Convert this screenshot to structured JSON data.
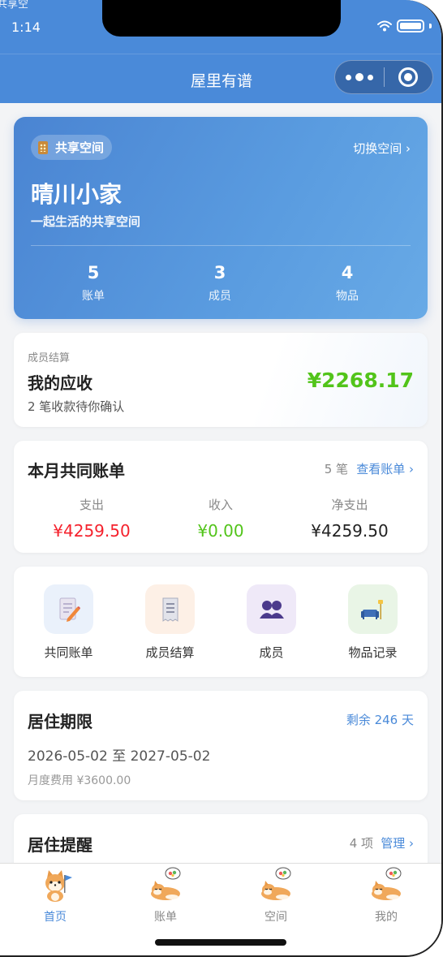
{
  "status": {
    "time": "1:14",
    "corner_text": "共享空"
  },
  "navbar": {
    "title": "屋里有谱"
  },
  "space": {
    "badge": "共享空间",
    "switch": "切换空间 ›",
    "name": "晴川小家",
    "desc": "一起生活的共享空间",
    "stats": [
      {
        "value": "5",
        "label": "账单"
      },
      {
        "value": "3",
        "label": "成员"
      },
      {
        "value": "4",
        "label": "物品"
      }
    ]
  },
  "settlement": {
    "caption": "成员结算",
    "title": "我的应收",
    "subtitle": "2 笔收款待你确认",
    "amount": "¥2268.17"
  },
  "bill": {
    "title": "本月共同账单",
    "count": "5 笔",
    "link": "查看账单 ›",
    "cols": [
      {
        "label": "支出",
        "value": "¥4259.50",
        "color": "#f5222d"
      },
      {
        "label": "收入",
        "value": "¥0.00",
        "color": "#52c41a"
      },
      {
        "label": "净支出",
        "value": "¥4259.50",
        "color": "#222222"
      }
    ]
  },
  "quick": [
    {
      "label": "共同账单",
      "icon": "bill-icon",
      "bg": "#eaf1fb"
    },
    {
      "label": "成员结算",
      "icon": "receipt-icon",
      "bg": "#fdf0e6"
    },
    {
      "label": "成员",
      "icon": "members-icon",
      "bg": "#efe9f8"
    },
    {
      "label": "物品记录",
      "icon": "sofa-icon",
      "bg": "#e9f5e6"
    }
  ],
  "stay": {
    "title": "居住期限",
    "remain": "剩余 246 天",
    "range": "2026-05-02 至 2027-05-02",
    "fee": "月度费用 ¥3600.00"
  },
  "reminder": {
    "title": "居住提醒",
    "count": "4 项",
    "link": "管理 ›"
  },
  "tabs": [
    {
      "label": "首页",
      "active": true
    },
    {
      "label": "账单",
      "active": false
    },
    {
      "label": "空间",
      "active": false
    },
    {
      "label": "我的",
      "active": false
    }
  ],
  "colors": {
    "primary": "#4a8ad9",
    "positive": "#52c41a",
    "negative": "#f5222d"
  }
}
